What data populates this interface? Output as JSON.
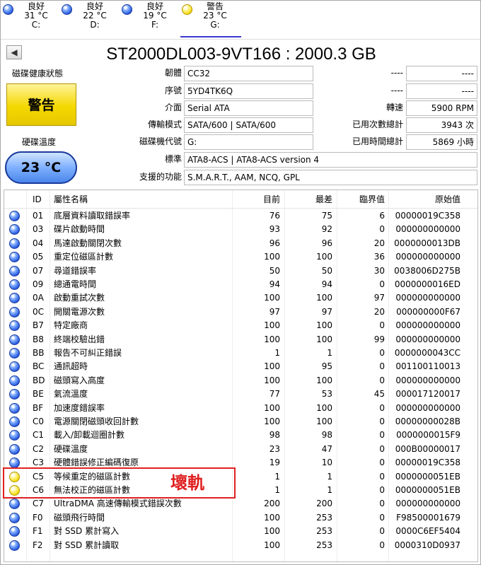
{
  "tabs": [
    {
      "status": "良好",
      "temp": "31 °C",
      "drive": "C:",
      "level": "good"
    },
    {
      "status": "良好",
      "temp": "22 °C",
      "drive": "D:",
      "level": "good"
    },
    {
      "status": "良好",
      "temp": "19 °C",
      "drive": "F:",
      "level": "good"
    },
    {
      "status": "警告",
      "temp": "23 °C",
      "drive": "G:",
      "level": "caution"
    }
  ],
  "model": "ST2000DL003-9VT166 : 2000.3 GB",
  "health": {
    "label": "磁碟健康狀態",
    "value": "警告"
  },
  "temperature": {
    "label": "硬碟溫度",
    "value": "23 °C"
  },
  "info": {
    "firmware_label": "韌體",
    "firmware": "CC32",
    "serial_label": "序號",
    "serial": "5YD4TK6Q",
    "interface_label": "介面",
    "interface": "Serial ATA",
    "transfer_label": "傳輸模式",
    "transfer": "SATA/600 | SATA/600",
    "letter_label": "磁碟機代號",
    "letter": "G:",
    "standard_label": "標準",
    "standard": "ATA8-ACS | ATA8-ACS version 4",
    "features_label": "支援的功能",
    "features": "S.M.A.R.T., AAM, NCQ, GPL",
    "blank1_label": "----",
    "blank1": "----",
    "blank2_label": "----",
    "blank2": "----",
    "rotation_label": "轉速",
    "rotation": "5900 RPM",
    "power_count_label": "已用次數總計",
    "power_count": "3943 次",
    "power_hours_label": "已用時間總計",
    "power_hours": "5869 小時"
  },
  "table": {
    "headers": {
      "id": "ID",
      "name": "屬性名稱",
      "current": "目前",
      "worst": "最差",
      "threshold": "臨界值",
      "raw": "原始值"
    },
    "rows": [
      {
        "status": "good",
        "id": "01",
        "name": "底層資料讀取錯誤率",
        "current": "76",
        "worst": "75",
        "threshold": "6",
        "raw": "00000019C358"
      },
      {
        "status": "good",
        "id": "03",
        "name": "碟片啟動時間",
        "current": "93",
        "worst": "92",
        "threshold": "0",
        "raw": "000000000000"
      },
      {
        "status": "good",
        "id": "04",
        "name": "馬達啟動關閉次數",
        "current": "96",
        "worst": "96",
        "threshold": "20",
        "raw": "0000000013DB"
      },
      {
        "status": "good",
        "id": "05",
        "name": "重定位磁區計數",
        "current": "100",
        "worst": "100",
        "threshold": "36",
        "raw": "000000000000"
      },
      {
        "status": "good",
        "id": "07",
        "name": "尋道錯誤率",
        "current": "50",
        "worst": "50",
        "threshold": "30",
        "raw": "0038006D275B"
      },
      {
        "status": "good",
        "id": "09",
        "name": "總通電時間",
        "current": "94",
        "worst": "94",
        "threshold": "0",
        "raw": "0000000016ED"
      },
      {
        "status": "good",
        "id": "0A",
        "name": "啟動重試次數",
        "current": "100",
        "worst": "100",
        "threshold": "97",
        "raw": "000000000000"
      },
      {
        "status": "good",
        "id": "0C",
        "name": "開關電源次數",
        "current": "97",
        "worst": "97",
        "threshold": "20",
        "raw": "000000000F67"
      },
      {
        "status": "good",
        "id": "B7",
        "name": "特定廠商",
        "current": "100",
        "worst": "100",
        "threshold": "0",
        "raw": "000000000000"
      },
      {
        "status": "good",
        "id": "B8",
        "name": "終端校驗出錯",
        "current": "100",
        "worst": "100",
        "threshold": "99",
        "raw": "000000000000"
      },
      {
        "status": "good",
        "id": "BB",
        "name": "報告不可糾正錯誤",
        "current": "1",
        "worst": "1",
        "threshold": "0",
        "raw": "0000000043CC"
      },
      {
        "status": "good",
        "id": "BC",
        "name": "通訊超時",
        "current": "100",
        "worst": "95",
        "threshold": "0",
        "raw": "001100110013"
      },
      {
        "status": "good",
        "id": "BD",
        "name": "磁頭寫入高度",
        "current": "100",
        "worst": "100",
        "threshold": "0",
        "raw": "000000000000"
      },
      {
        "status": "good",
        "id": "BE",
        "name": "氣流溫度",
        "current": "77",
        "worst": "53",
        "threshold": "45",
        "raw": "000017120017"
      },
      {
        "status": "good",
        "id": "BF",
        "name": "加速度錯誤率",
        "current": "100",
        "worst": "100",
        "threshold": "0",
        "raw": "000000000000"
      },
      {
        "status": "good",
        "id": "C0",
        "name": "電源關閉磁頭收回計數",
        "current": "100",
        "worst": "100",
        "threshold": "0",
        "raw": "00000000028B"
      },
      {
        "status": "good",
        "id": "C1",
        "name": "載入/卸載迴圈計數",
        "current": "98",
        "worst": "98",
        "threshold": "0",
        "raw": "0000000015F9"
      },
      {
        "status": "good",
        "id": "C2",
        "name": "硬碟溫度",
        "current": "23",
        "worst": "47",
        "threshold": "0",
        "raw": "000B00000017"
      },
      {
        "status": "good",
        "id": "C3",
        "name": "硬體錯誤修正編碼復原",
        "current": "19",
        "worst": "10",
        "threshold": "0",
        "raw": "00000019C358"
      },
      {
        "status": "caution",
        "id": "C5",
        "name": "等候重定的磁區計數",
        "current": "1",
        "worst": "1",
        "threshold": "0",
        "raw": "0000000051EB"
      },
      {
        "status": "caution",
        "id": "C6",
        "name": "無法校正的磁區計數",
        "current": "1",
        "worst": "1",
        "threshold": "0",
        "raw": "0000000051EB"
      },
      {
        "status": "good",
        "id": "C7",
        "name": "UltraDMA 高速傳輸模式錯誤次數",
        "current": "200",
        "worst": "200",
        "threshold": "0",
        "raw": "000000000000"
      },
      {
        "status": "good",
        "id": "F0",
        "name": "磁頭飛行時間",
        "current": "100",
        "worst": "253",
        "threshold": "0",
        "raw": "F98500001679"
      },
      {
        "status": "good",
        "id": "F1",
        "name": "對 SSD 累計寫入",
        "current": "100",
        "worst": "253",
        "threshold": "0",
        "raw": "0000C6EF5404"
      },
      {
        "status": "good",
        "id": "F2",
        "name": "對 SSD 累計讀取",
        "current": "100",
        "worst": "253",
        "threshold": "0",
        "raw": "0000310D0937"
      }
    ]
  },
  "annotation": {
    "text": "壞軌",
    "color": "#e02020"
  }
}
